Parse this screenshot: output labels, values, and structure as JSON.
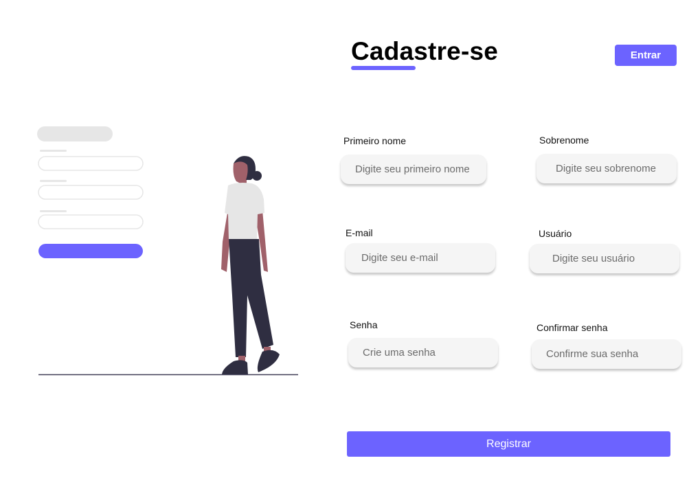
{
  "header": {
    "title": "Cadastre-se",
    "login_label": "Entrar"
  },
  "form": {
    "first_name": {
      "label": "Primeiro nome",
      "placeholder": "Digite seu primeiro nome",
      "value": ""
    },
    "last_name": {
      "label": "Sobrenome",
      "placeholder": "Digite seu sobrenome",
      "value": ""
    },
    "email": {
      "label": "E-mail",
      "placeholder": "Digite seu e-mail",
      "value": ""
    },
    "username": {
      "label": "Usuário",
      "placeholder": "Digite seu usuário",
      "value": ""
    },
    "password": {
      "label": "Senha",
      "placeholder": "Crie uma senha",
      "value": ""
    },
    "confirm_password": {
      "label": "Confirmar senha",
      "placeholder": "Confirme sua senha",
      "value": ""
    },
    "submit_label": "Registrar"
  },
  "illustration": {
    "icon": "person-walking-signup-illustration"
  },
  "colors": {
    "accent": "#6c63ff",
    "input_background": "#f5f5f5",
    "figure_shirt": "#e6e6e6",
    "figure_pants": "#2f2e41",
    "figure_skin": "#a0616a"
  }
}
